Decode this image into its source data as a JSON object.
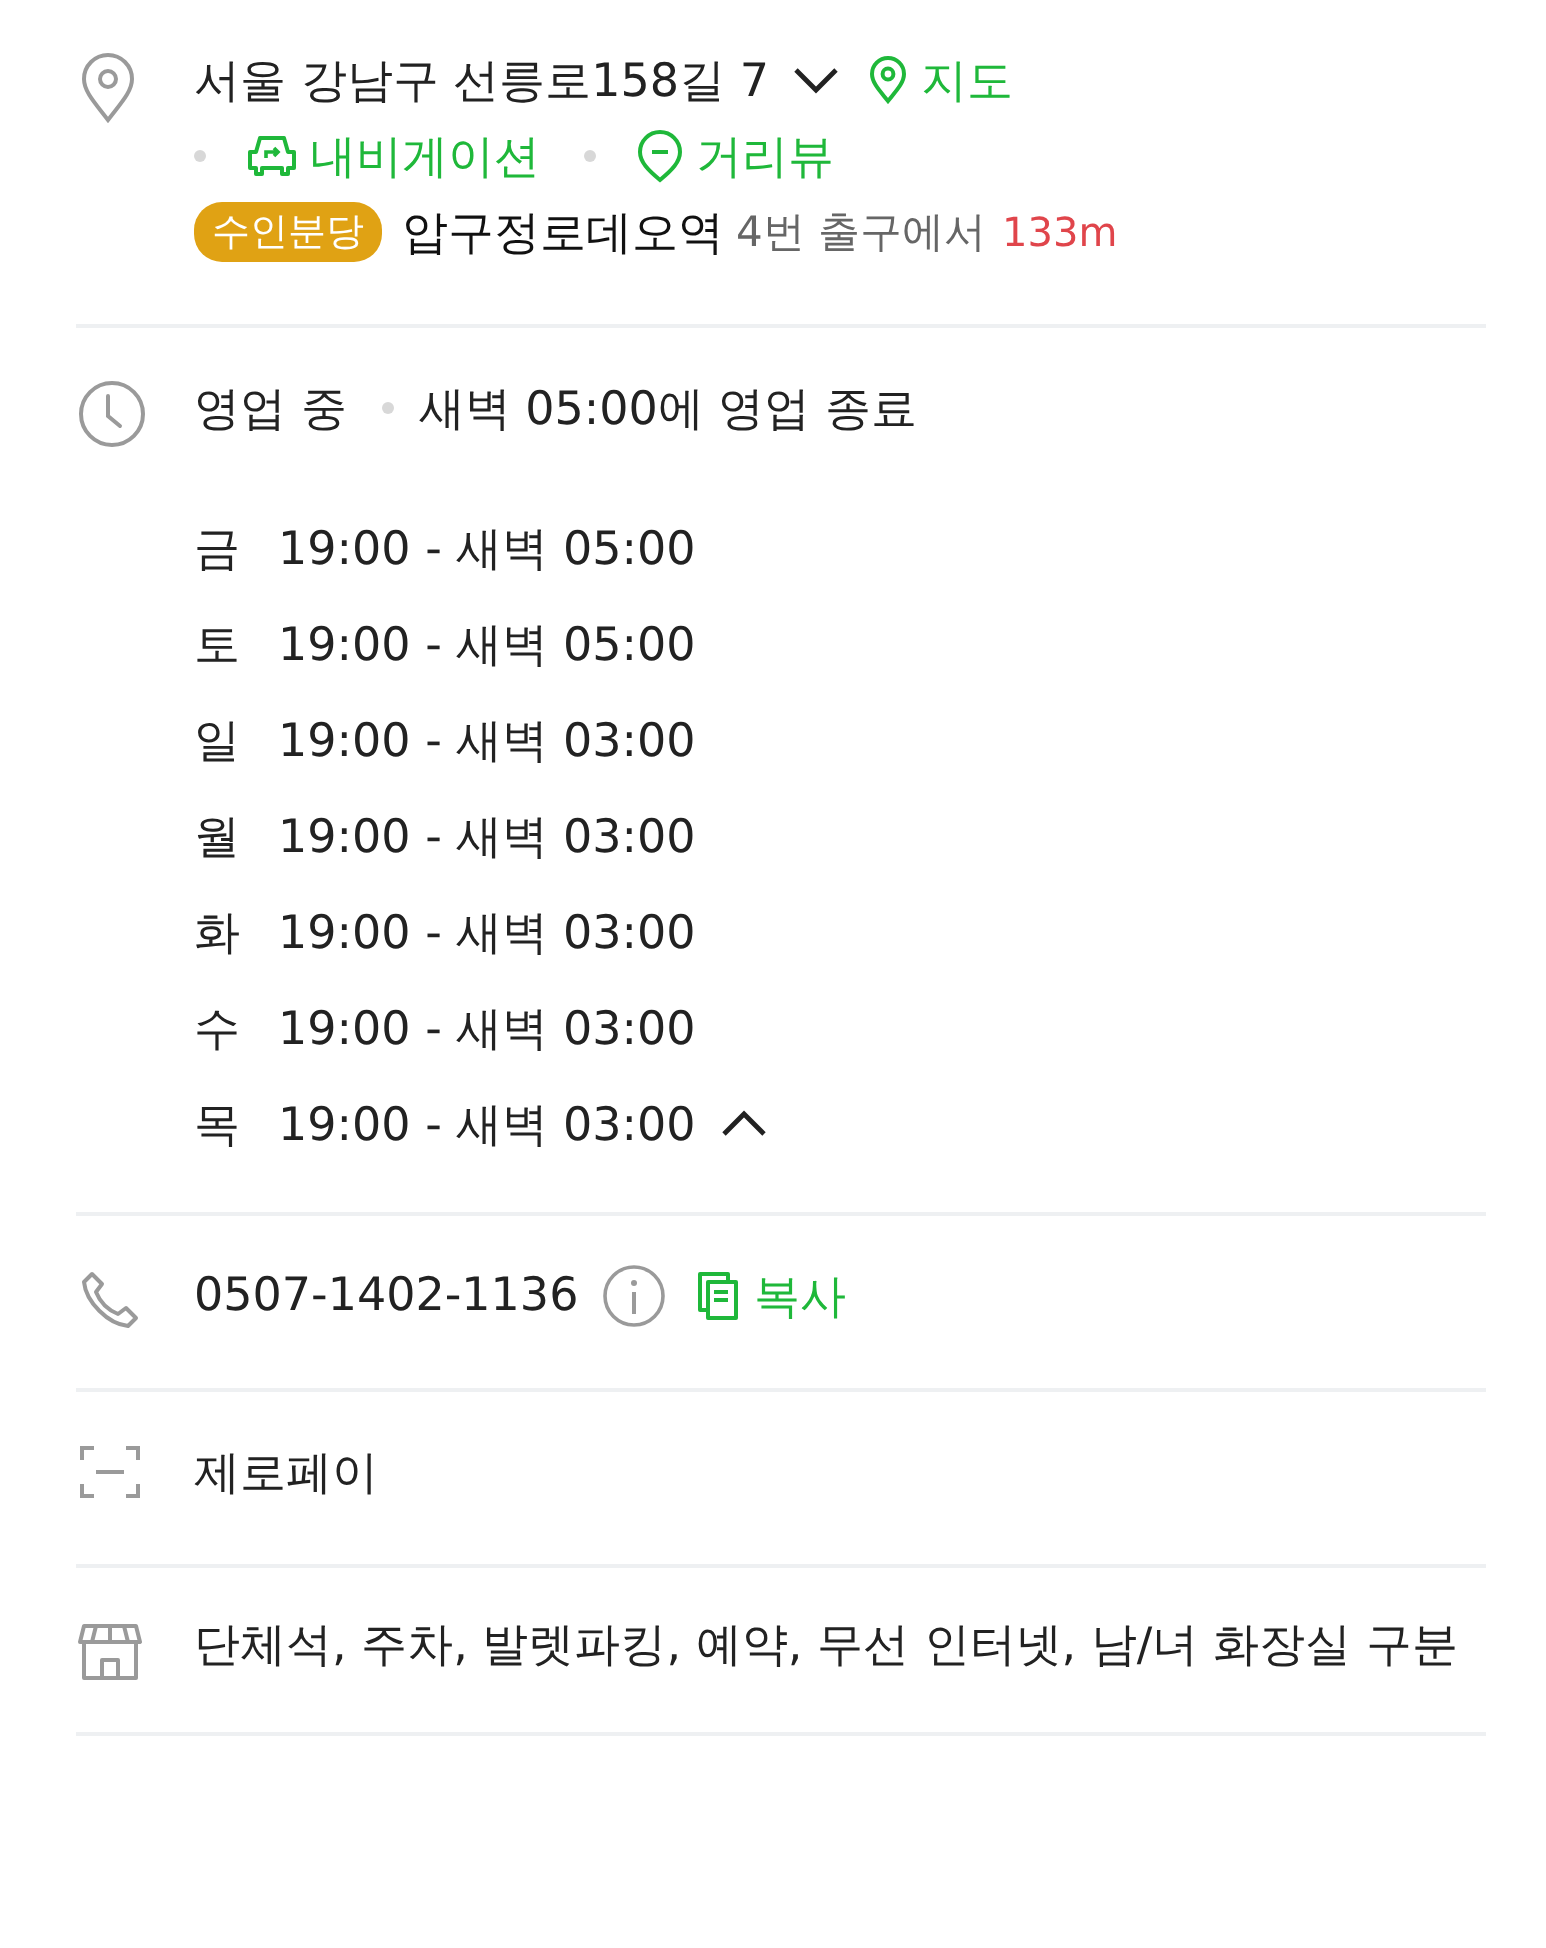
{
  "address": {
    "text": "서울 강남구 선릉로158길 7",
    "expanded": false,
    "map_link": "지도"
  },
  "links": [
    {
      "label": "내비게이션",
      "kind": "navigation"
    },
    {
      "label": "거리뷰",
      "kind": "streetview"
    }
  ],
  "transit": {
    "line": "수인분당",
    "station": "압구정로데오역",
    "exit": "4번 출구에서",
    "distance": "133m"
  },
  "hours": {
    "status": "영업 중",
    "note": "새벽 05:00에 영업 종료",
    "expanded": true,
    "days": [
      {
        "day": "금",
        "time": "19:00 - 새벽 05:00"
      },
      {
        "day": "토",
        "time": "19:00 - 새벽 05:00"
      },
      {
        "day": "일",
        "time": "19:00 - 새벽 03:00"
      },
      {
        "day": "월",
        "time": "19:00 - 새벽 03:00"
      },
      {
        "day": "화",
        "time": "19:00 - 새벽 03:00"
      },
      {
        "day": "수",
        "time": "19:00 - 새벽 03:00"
      },
      {
        "day": "목",
        "time": "19:00 - 새벽 03:00"
      }
    ]
  },
  "phone": {
    "number": "0507-1402-1136",
    "copy": "복사"
  },
  "payment": "제로페이",
  "amenities": "단체석, 주차, 발렛파킹, 예약, 무선 인터넷, 남/녀 화장실 구분"
}
